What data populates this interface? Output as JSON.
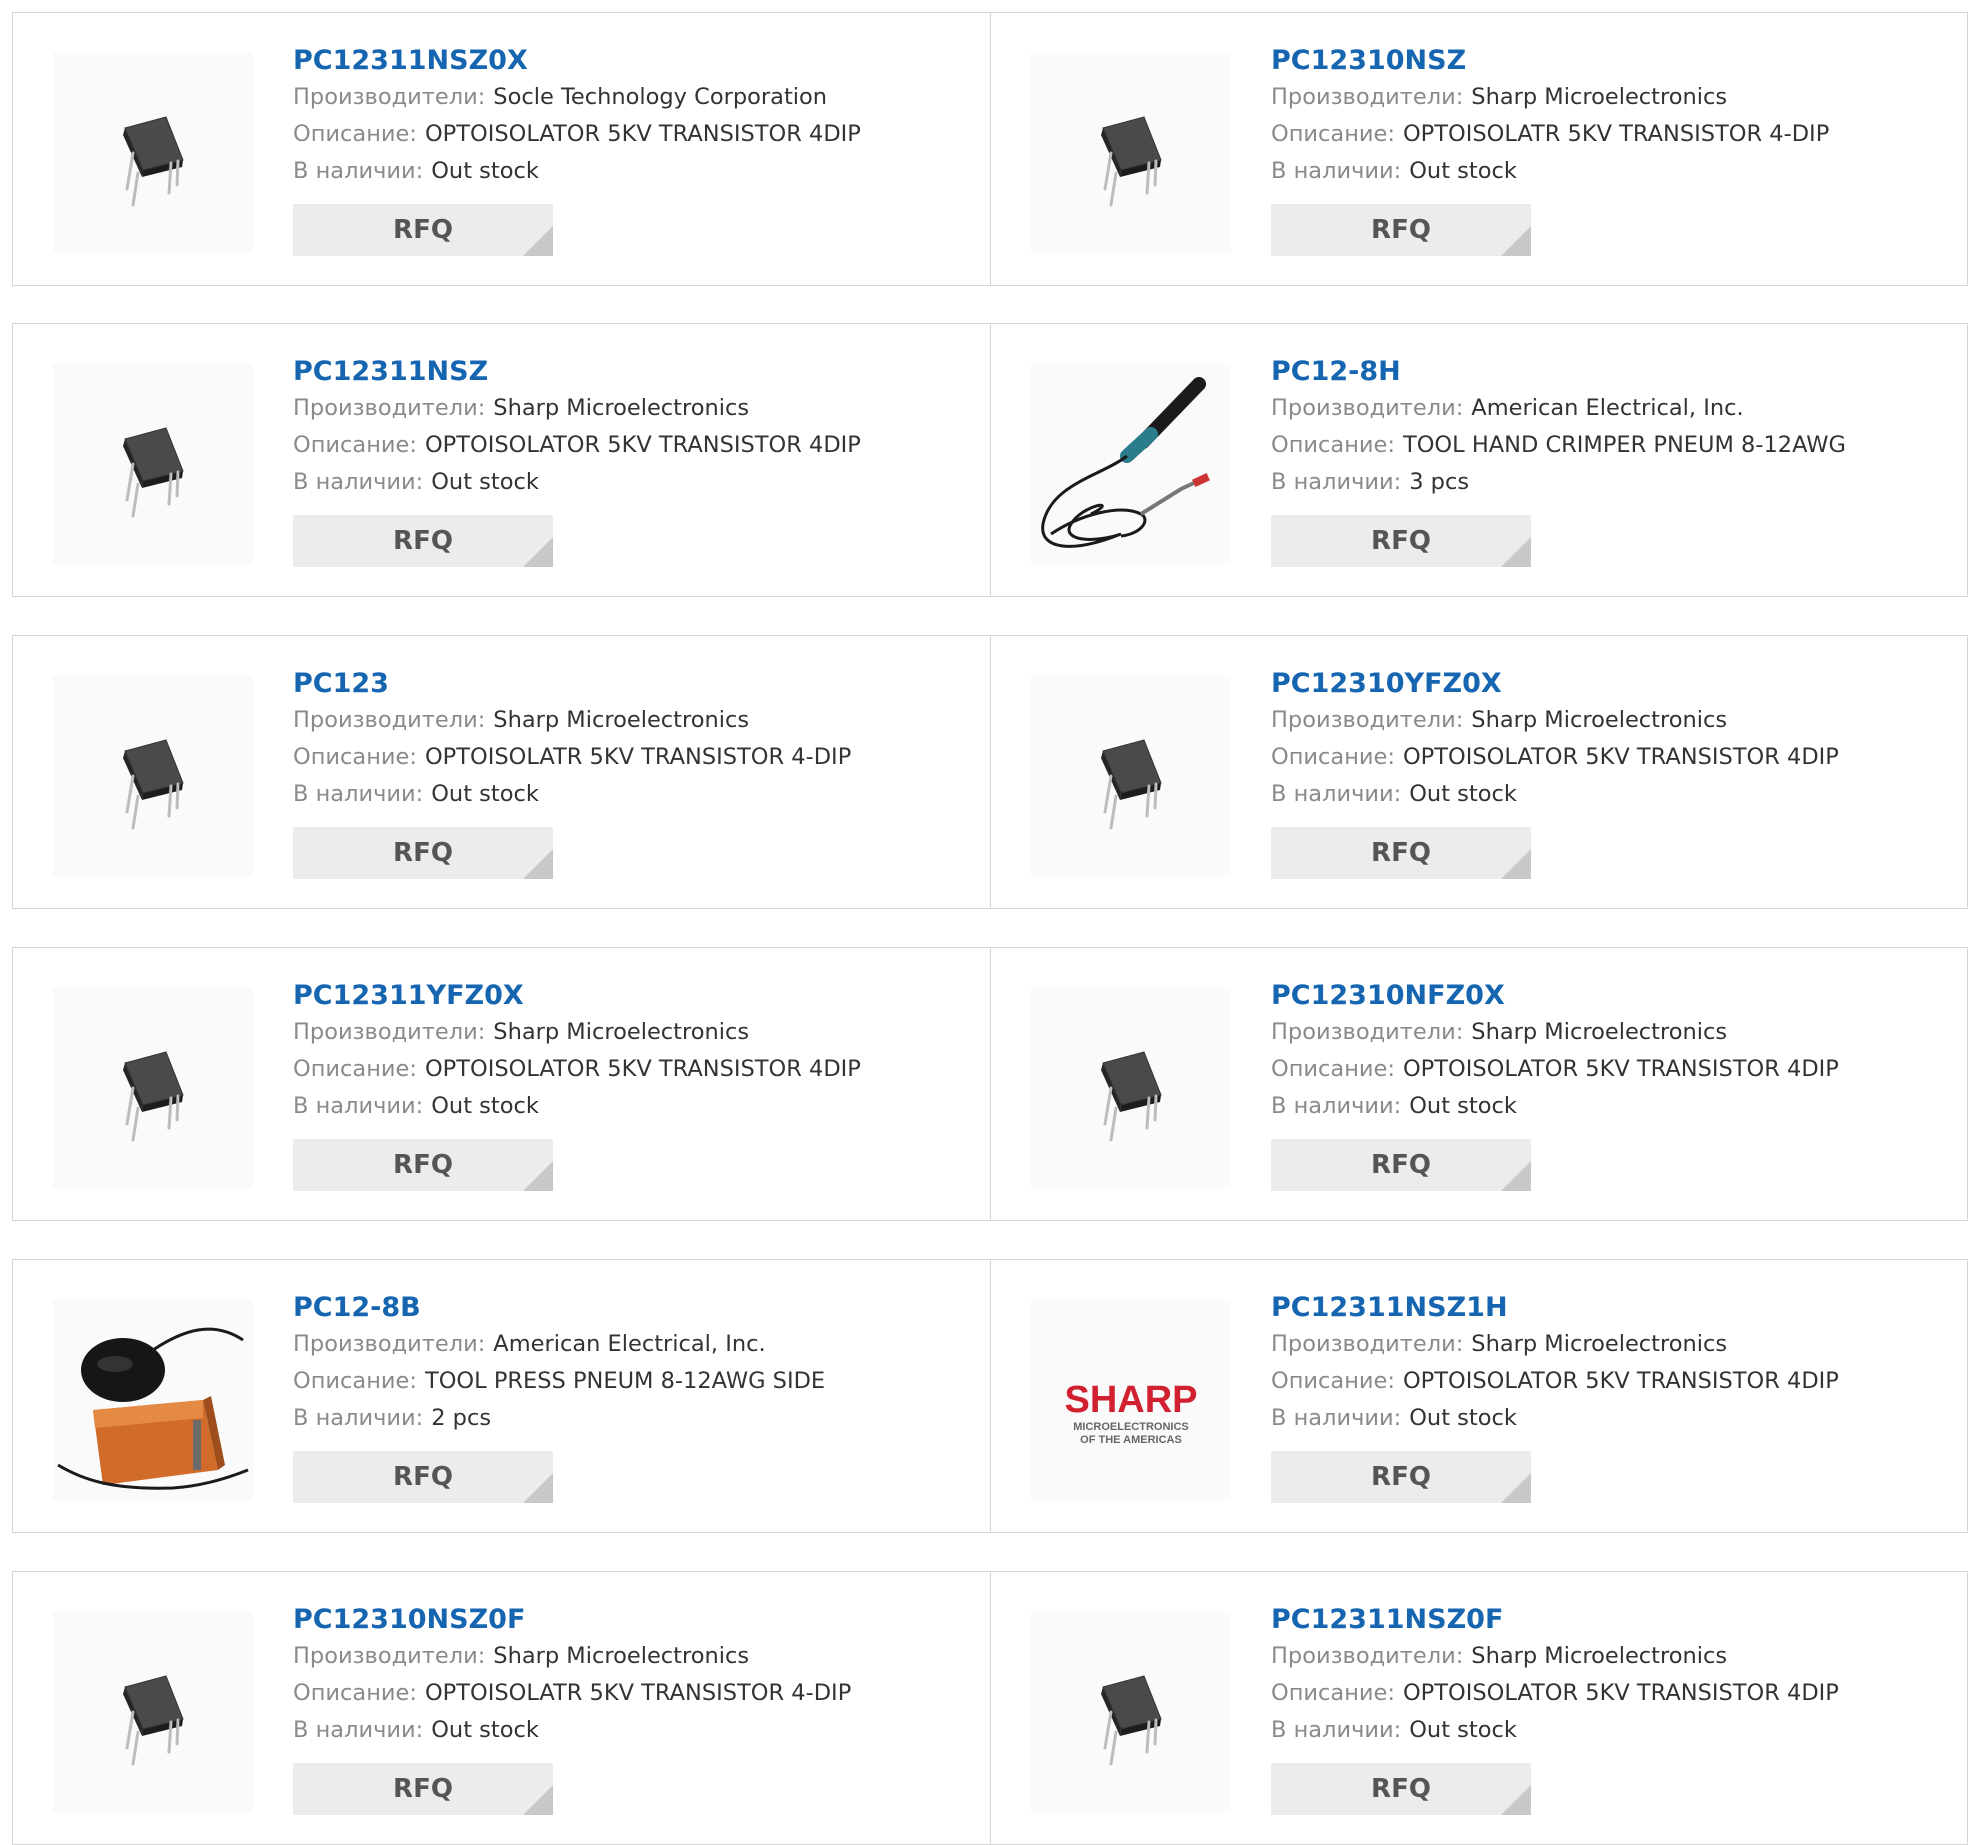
{
  "labels": {
    "manufacturer": "Производители:",
    "description": "Описание:",
    "stock": "В наличии:",
    "rfq": "RFQ"
  },
  "colors": {
    "part_link": "#1565b0",
    "label": "#8a8a8a",
    "value": "#333333",
    "rfq_bg": "#ececec",
    "border": "#d6d6d6"
  },
  "products": [
    {
      "part": "PC12311NSZ0X",
      "manufacturer": "Socle Technology Corporation",
      "description": "OPTOISOLATOR 5KV TRANSISTOR 4DIP",
      "stock": "Out stock",
      "image": "dip4-chip"
    },
    {
      "part": "PC12310NSZ",
      "manufacturer": "Sharp Microelectronics",
      "description": "OPTOISOLATR 5KV TRANSISTOR 4-DIP",
      "stock": "Out stock",
      "image": "dip4-chip"
    },
    {
      "part": "PC12311NSZ",
      "manufacturer": "Sharp Microelectronics",
      "description": "OPTOISOLATOR 5KV TRANSISTOR 4DIP",
      "stock": "Out stock",
      "image": "dip4-chip"
    },
    {
      "part": "PC12-8H",
      "manufacturer": "American Electrical, Inc.",
      "description": "TOOL HAND CRIMPER PNEUM 8-12AWG",
      "stock": "3 pcs",
      "image": "crimper-tool"
    },
    {
      "part": "PC123",
      "manufacturer": "Sharp Microelectronics",
      "description": "OPTOISOLATR 5KV TRANSISTOR 4-DIP",
      "stock": "Out stock",
      "image": "dip4-chip"
    },
    {
      "part": "PC12310YFZ0X",
      "manufacturer": "Sharp Microelectronics",
      "description": "OPTOISOLATOR 5KV TRANSISTOR 4DIP",
      "stock": "Out stock",
      "image": "dip4-chip"
    },
    {
      "part": "PC12311YFZ0X",
      "manufacturer": "Sharp Microelectronics",
      "description": "OPTOISOLATOR 5KV TRANSISTOR 4DIP",
      "stock": "Out stock",
      "image": "dip4-chip"
    },
    {
      "part": "PC12310NFZ0X",
      "manufacturer": "Sharp Microelectronics",
      "description": "OPTOISOLATOR 5KV TRANSISTOR 4DIP",
      "stock": "Out stock",
      "image": "dip4-chip"
    },
    {
      "part": "PC12-8B",
      "manufacturer": "American Electrical, Inc.",
      "description": "TOOL PRESS PNEUM 8-12AWG SIDE",
      "stock": "2 pcs",
      "image": "press-tool"
    },
    {
      "part": "PC12311NSZ1H",
      "manufacturer": "Sharp Microelectronics",
      "description": "OPTOISOLATOR 5KV TRANSISTOR 4DIP",
      "stock": "Out stock",
      "image": "sharp-logo",
      "logo_text": {
        "brand": "SHARP",
        "line1": "MICROELECTRONICS",
        "line2": "OF THE AMERICAS"
      }
    },
    {
      "part": "PC12310NSZ0F",
      "manufacturer": "Sharp Microelectronics",
      "description": "OPTOISOLATR 5KV TRANSISTOR 4-DIP",
      "stock": "Out stock",
      "image": "dip4-chip"
    },
    {
      "part": "PC12311NSZ0F",
      "manufacturer": "Sharp Microelectronics",
      "description": "OPTOISOLATOR 5KV TRANSISTOR 4DIP",
      "stock": "Out stock",
      "image": "dip4-chip"
    }
  ]
}
